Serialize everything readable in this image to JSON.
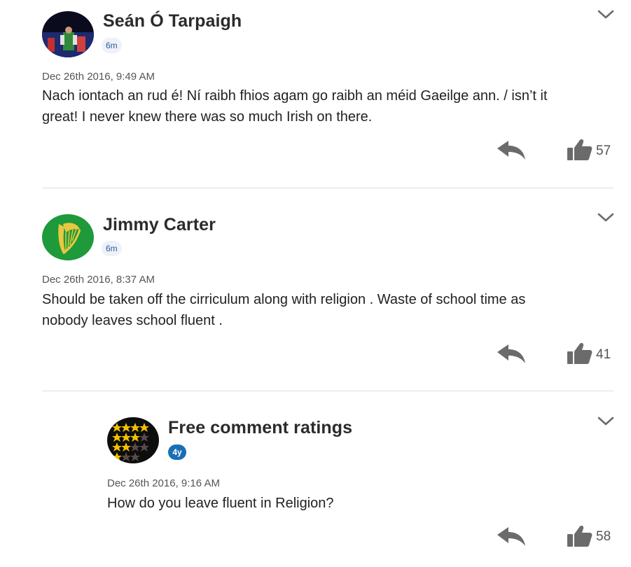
{
  "comments": [
    {
      "author": "Seán Ó Tarpaigh",
      "age": "6m",
      "date": "Dec 26th 2016, 9:49 AM",
      "text_line1": "Nach iontach an rud é! Ní raibh fhios agam go raibh an méid Gaeilge ann. / isn’t it",
      "text_line2": "great! I never knew there was so much Irish on there.",
      "likes": "57",
      "avatar_icon": "flag-photo-avatar"
    },
    {
      "author": "Jimmy Carter",
      "age": "6m",
      "date": "Dec 26th 2016, 8:37 AM",
      "text_line1": "Should be taken off the cirriculum along with religion . Waste of school time as",
      "text_line2": "nobody leaves school fluent .",
      "likes": "41",
      "avatar_icon": "harp-avatar"
    },
    {
      "author": "Free comment ratings",
      "age": "4y",
      "date": "Dec 26th 2016, 9:16 AM",
      "text_line1": "How do you leave fluent in Religion?",
      "likes": "58",
      "avatar_icon": "stars-avatar"
    }
  ],
  "colors": {
    "badge_blue": "#1a6fb4",
    "icon_gray": "#6b6b6b",
    "harp_green": "#1e9a3a",
    "star_gold": "#f2c200"
  }
}
